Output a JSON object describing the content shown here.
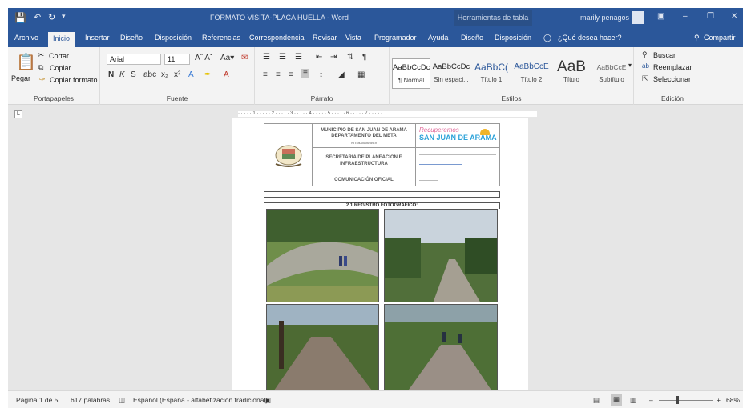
{
  "titlebar": {
    "title": "FORMATO VISITA-PLACA HUELLA - Word",
    "tools": "Herramientas de tabla",
    "user": "marily penagos"
  },
  "tabs": [
    "Archivo",
    "Inicio",
    "Insertar",
    "Diseño",
    "Disposición",
    "Referencias",
    "Correspondencia",
    "Revisar",
    "Vista",
    "Programador",
    "Ayuda",
    "Diseño",
    "Disposición"
  ],
  "tell_me": "¿Qué desea hacer?",
  "share": "Compartir",
  "clipboard": {
    "paste": "Pegar",
    "cut": "Cortar",
    "copy": "Copiar",
    "format": "Copiar formato",
    "label": "Portapapeles"
  },
  "font": {
    "family": "Arial",
    "size": "11",
    "label": "Fuente"
  },
  "paragraph": {
    "label": "Párrafo"
  },
  "styles": {
    "label": "Estilos",
    "items": [
      {
        "preview": "AaBbCcDc",
        "name": "¶ Normal"
      },
      {
        "preview": "AaBbCcDc",
        "name": "Sin espaci..."
      },
      {
        "preview": "AaBbC(",
        "name": "Título 1"
      },
      {
        "preview": "AaBbCcE",
        "name": "Título 2"
      },
      {
        "preview": "AaB",
        "name": "Título"
      },
      {
        "preview": "AaBbCcE",
        "name": "Subtítulo"
      }
    ]
  },
  "editing": {
    "find": "Buscar",
    "replace": "Reemplazar",
    "select": "Seleccionar",
    "label": "Edición"
  },
  "document": {
    "muni1": "MUNICIPIO DE SAN JUAN DE ARAMA",
    "muni2": "DEPARTAMENTO DEL META",
    "nit": "NIT: 800098259-9",
    "secretaria1": "SECRETARIA DE PLANEACION E",
    "secretaria2": "INFRAESTRUCTURA",
    "comunicacion": "COMUNICACIÓN OFICIAL",
    "logo_top": "Recuperemos",
    "logo_main": "SAN JUAN DE ARAMA",
    "section": "2.1      REGISTRO FOTOGRAFICO:"
  },
  "status": {
    "page": "Página 1 de 5",
    "words": "617 palabras",
    "language": "Español (España - alfabetización tradicional)",
    "zoom": "68%"
  },
  "colors": {
    "brand": "#2b579a"
  }
}
